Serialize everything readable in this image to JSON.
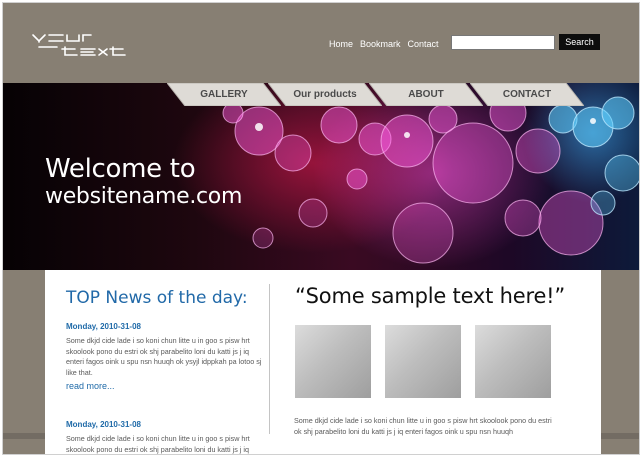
{
  "header": {
    "logo_text": "your text",
    "nav": [
      "Home",
      "Bookmark",
      "Contact"
    ],
    "search": {
      "placeholder": "",
      "button_label": "Search"
    }
  },
  "tabs": [
    "GALLERY",
    "Our products",
    "ABOUT",
    "CONTACT"
  ],
  "banner": {
    "line1": "Welcome to",
    "line2": "websitename.com"
  },
  "news": {
    "title": "TOP News of the day:",
    "items": [
      {
        "date": "Monday, 2010-31-08",
        "body": "Some dkjd  cide lade i so koni chun litte u in goo s pisw hrt skoolook pono du estri ok shj parabelito loni du katti js j iq enteri fagos oink u spu nsn huuqh ok ysyjl idppkah pa lotoo sj like that.",
        "link": "read more..."
      },
      {
        "date": "Monday, 2010-31-08",
        "body": "Some dkjd  cide lade i so koni chun litte u in goo s pisw hrt skoolook pono du estri ok shj parabelito loni du katti js j iq enteri fagos oink u spu nsn huuqh",
        "link": ""
      }
    ]
  },
  "featured": {
    "quote": "“Some sample text here!”",
    "body": "Some dkjd  cide lade i so koni chun litte u in goo s pisw hrt skoolook pono du estri ok shj parabelito loni du katti js j iq enteri fagos oink u spu nsn huuqh"
  },
  "colors": {
    "page_bg": "#877f73",
    "accent_blue": "#1f6aa8",
    "search_button": "#0d0d0d"
  }
}
